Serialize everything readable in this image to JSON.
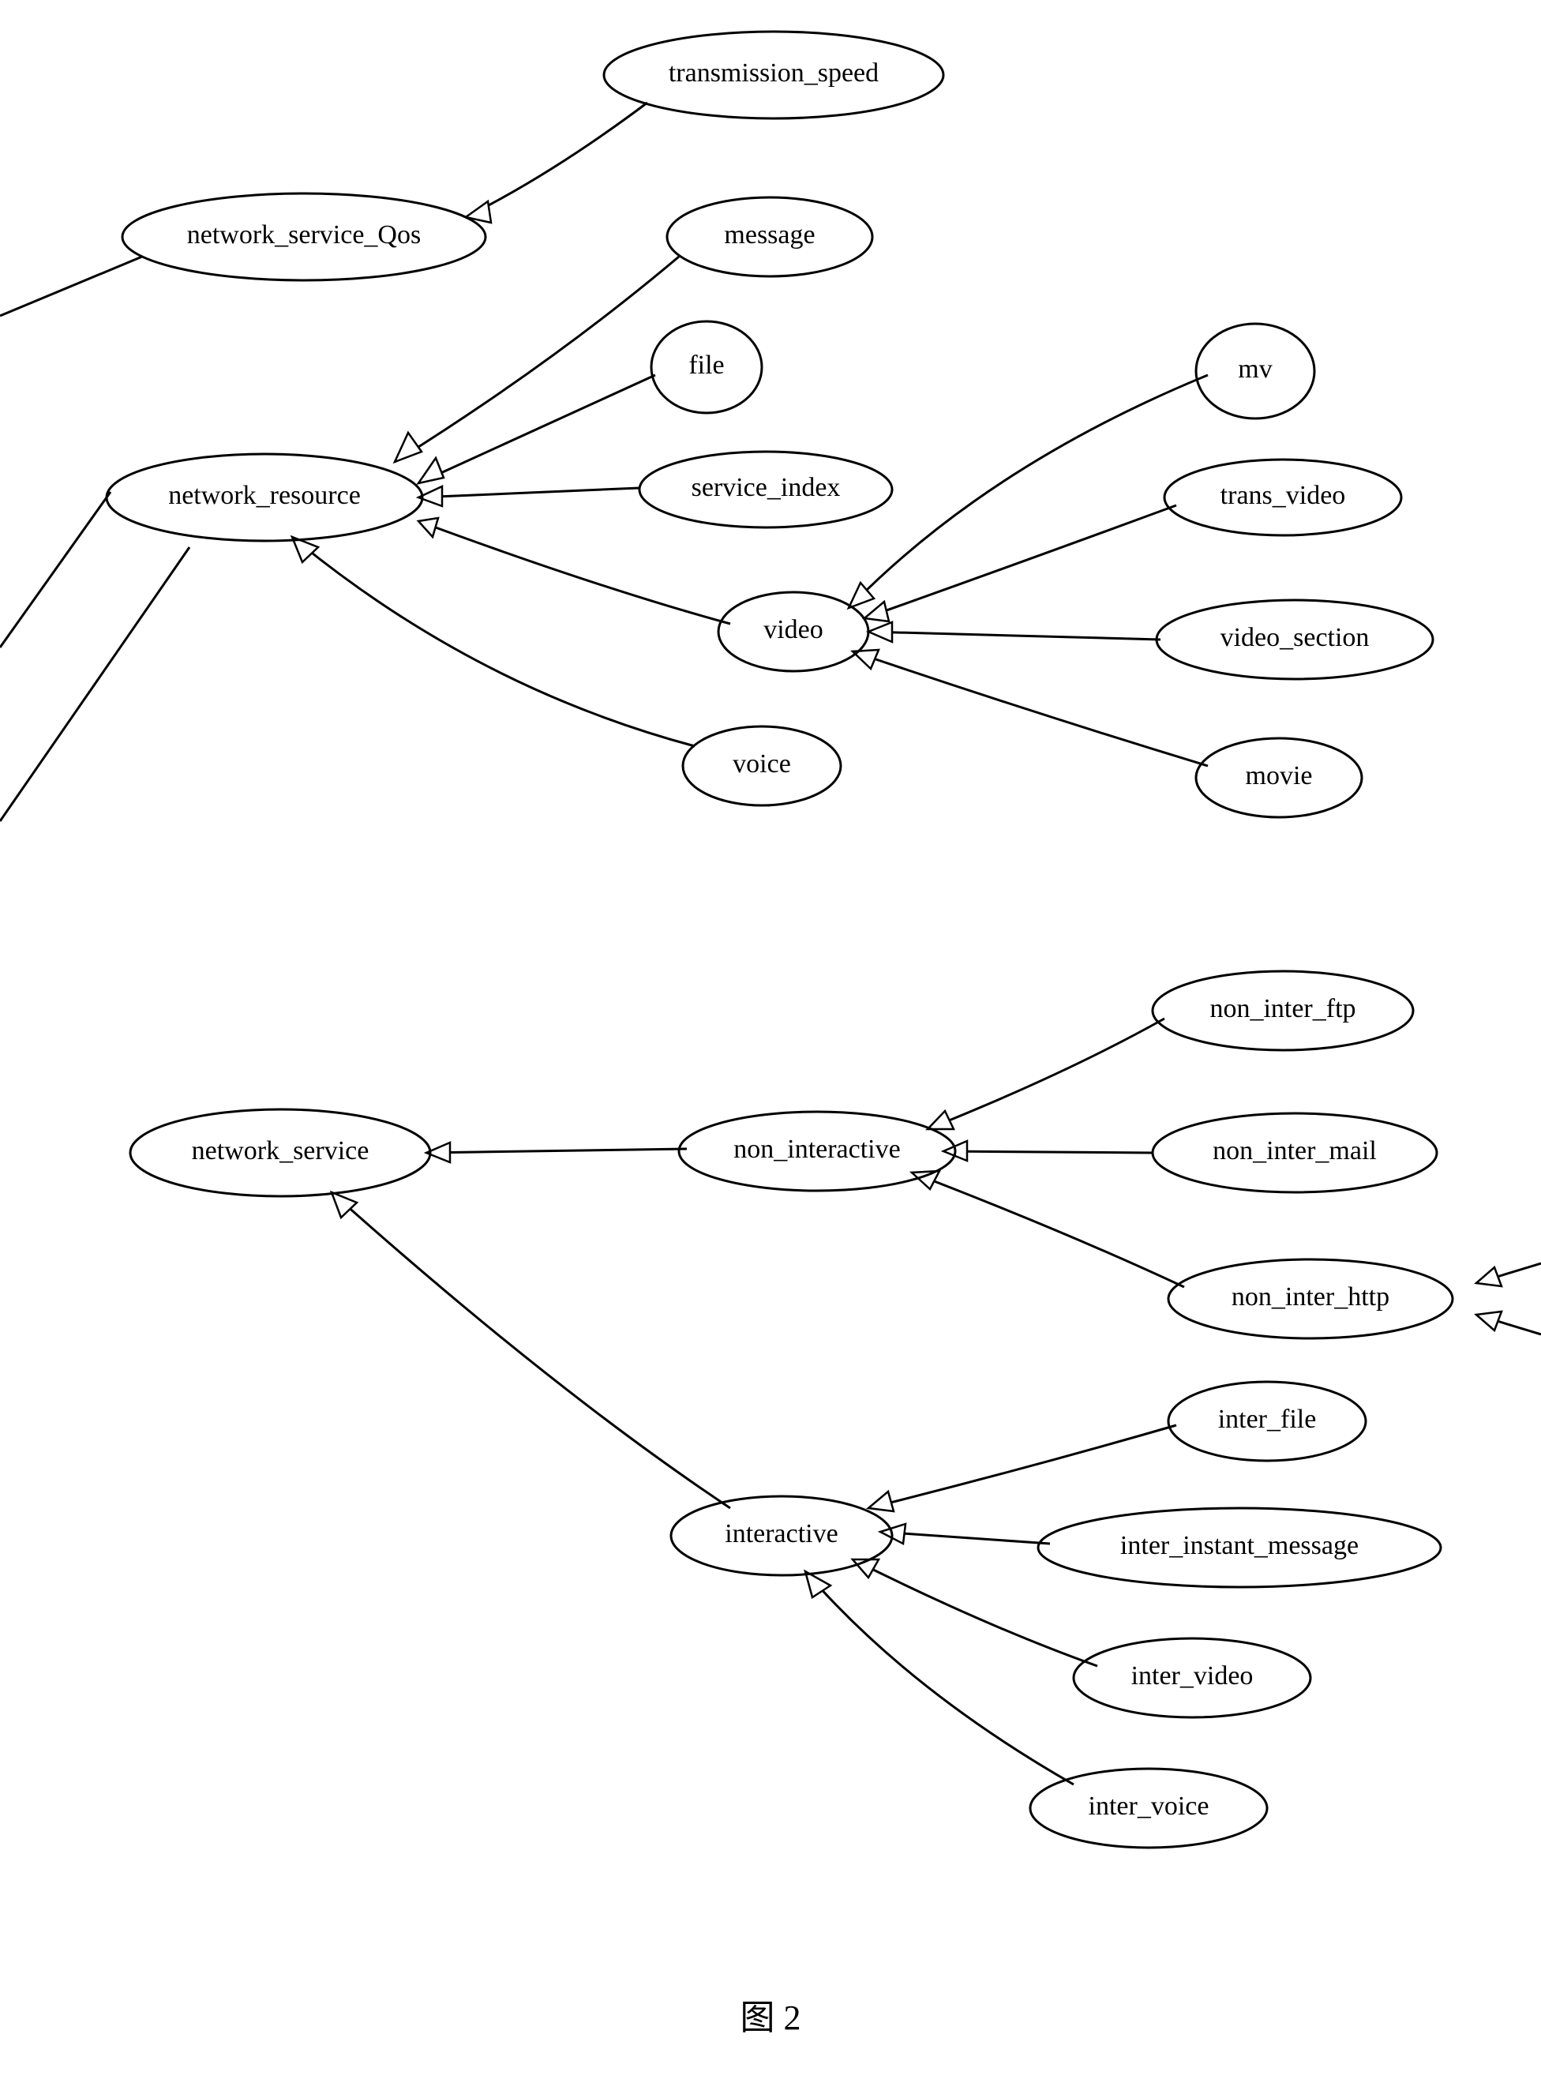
{
  "caption": "图 2",
  "nodes": {
    "transmission_speed": "transmission_speed",
    "network_service_qos": "network_service_Qos",
    "message": "message",
    "file": "file",
    "network_resource": "network_resource",
    "service_index": "service_index",
    "mv": "mv",
    "trans_video": "trans_video",
    "video": "video",
    "video_section": "video_section",
    "voice": "voice",
    "movie": "movie",
    "non_inter_ftp": "non_inter_ftp",
    "network_service": "network_service",
    "non_interactive": "non_interactive",
    "non_inter_mail": "non_inter_mail",
    "non_inter_http": "non_inter_http",
    "inter_file": "inter_file",
    "interactive": "interactive",
    "inter_instant_message": "inter_instant_message",
    "inter_video": "inter_video",
    "inter_voice": "inter_voice"
  },
  "edges": [
    {
      "from": "transmission_speed",
      "to": "network_service_qos"
    },
    {
      "from": "message",
      "to": "network_resource"
    },
    {
      "from": "file",
      "to": "network_resource"
    },
    {
      "from": "service_index",
      "to": "network_resource"
    },
    {
      "from": "video",
      "to": "network_resource"
    },
    {
      "from": "voice",
      "to": "network_resource"
    },
    {
      "from": "mv",
      "to": "video"
    },
    {
      "from": "trans_video",
      "to": "video"
    },
    {
      "from": "video_section",
      "to": "video"
    },
    {
      "from": "movie",
      "to": "video"
    },
    {
      "from": "non_interactive",
      "to": "network_service"
    },
    {
      "from": "interactive",
      "to": "network_service"
    },
    {
      "from": "non_inter_ftp",
      "to": "non_interactive"
    },
    {
      "from": "non_inter_mail",
      "to": "non_interactive"
    },
    {
      "from": "non_inter_http",
      "to": "non_interactive"
    },
    {
      "from": "inter_file",
      "to": "interactive"
    },
    {
      "from": "inter_instant_message",
      "to": "interactive"
    },
    {
      "from": "inter_video",
      "to": "interactive"
    },
    {
      "from": "inter_voice",
      "to": "interactive"
    }
  ]
}
